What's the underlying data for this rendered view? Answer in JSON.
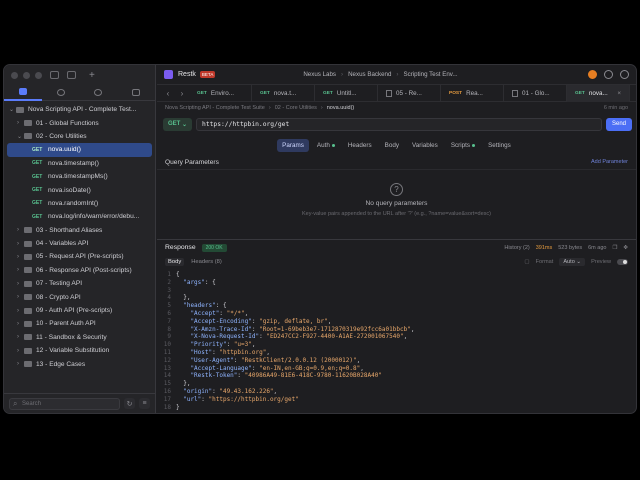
{
  "sidebar": {
    "root": "Nova Scripting API - Complete Test...",
    "folders_before": [
      {
        "label": "01 - Global Functions"
      },
      {
        "label": "02 - Core Utilities"
      }
    ],
    "requests": [
      {
        "method": "GET",
        "label": "nova.uuid()",
        "selected": true
      },
      {
        "method": "GET",
        "label": "nova.timestamp()"
      },
      {
        "method": "GET",
        "label": "nova.timestampMs()"
      },
      {
        "method": "GET",
        "label": "nova.isoDate()"
      },
      {
        "method": "GET",
        "label": "nova.randomInt()"
      },
      {
        "method": "GET",
        "label": "nova.log/info/warn/error/debu..."
      }
    ],
    "folders_after": [
      {
        "label": "03 - Shorthand Aliases"
      },
      {
        "label": "04 - Variables API"
      },
      {
        "label": "05 - Request API (Pre-scripts)"
      },
      {
        "label": "06 - Response API (Post-scripts)"
      },
      {
        "label": "07 - Testing API"
      },
      {
        "label": "08 - Crypto API"
      },
      {
        "label": "09 - Auth API (Pre-scripts)"
      },
      {
        "label": "10 - Parent Auth API"
      },
      {
        "label": "11 - Sandbox & Security"
      },
      {
        "label": "12 - Variable Substitution"
      },
      {
        "label": "13 - Edge Cases"
      }
    ],
    "search_placeholder": "Search"
  },
  "topbar": {
    "app": "Restk",
    "badge": "BETA",
    "crumbs": [
      "Nexus Labs",
      "Nexus Backend",
      "Scripting Test Env..."
    ]
  },
  "tabs": [
    {
      "method": "GET",
      "label": "Enviro...",
      "active": false
    },
    {
      "method": "GET",
      "label": "nova.t...",
      "active": false
    },
    {
      "method": "GET",
      "label": "Untitl...",
      "active": false
    },
    {
      "method": "",
      "label": "05 - Re...",
      "active": false
    },
    {
      "method": "POST",
      "label": "Rea...",
      "active": false
    },
    {
      "method": "",
      "label": "01 - Glo...",
      "active": false
    },
    {
      "method": "GET",
      "label": "nova...",
      "active": true
    }
  ],
  "request": {
    "crumb": [
      "Nova Scripting API - Complete Test Suite",
      "02 - Core Utilities",
      "nova.uuid()"
    ],
    "ago": "6 min ago",
    "method": "GET",
    "url": "https://httpbin.org/get",
    "send": "Send",
    "tabs": [
      "Params",
      "Auth",
      "Headers",
      "Body",
      "Variables",
      "Scripts",
      "Settings"
    ],
    "active_tab": "Params"
  },
  "query": {
    "title": "Query Parameters",
    "add": "Add Parameter",
    "empty_title": "No query parameters",
    "empty_hint": "Key-value pairs appended to the URL after '?' (e.g., ?name=value&sort=desc)"
  },
  "response": {
    "title": "Response",
    "status": "200 OK",
    "history": "History (2)",
    "time": "391ms",
    "size": "523 bytes",
    "ago": "6m ago",
    "tabs": [
      "Body",
      "Headers (8)"
    ],
    "format_label": "Format",
    "format_value": "Auto",
    "preview_label": "Preview",
    "lines": [
      [
        [
          "p",
          "{"
        ]
      ],
      [
        [
          "k",
          "  \"args\""
        ],
        [
          "p",
          ": {"
        ]
      ],
      [
        [
          "p",
          ""
        ]
      ],
      [
        [
          "p",
          "  },"
        ]
      ],
      [
        [
          "k",
          "  \"headers\""
        ],
        [
          "p",
          ": {"
        ]
      ],
      [
        [
          "k",
          "    \"Accept\""
        ],
        [
          "p",
          ": "
        ],
        [
          "s",
          "\"*/*\""
        ],
        [
          "p",
          ","
        ]
      ],
      [
        [
          "k",
          "    \"Accept-Encoding\""
        ],
        [
          "p",
          ": "
        ],
        [
          "s",
          "\"gzip, deflate, br\""
        ],
        [
          "p",
          ","
        ]
      ],
      [
        [
          "k",
          "    \"X-Amzn-Trace-Id\""
        ],
        [
          "p",
          ": "
        ],
        [
          "s",
          "\"Root=1-69beb3e7-1712870319e92fcc6a01bbcb\""
        ],
        [
          "p",
          ","
        ]
      ],
      [
        [
          "k",
          "    \"X-Nova-Request-Id\""
        ],
        [
          "p",
          ": "
        ],
        [
          "s",
          "\"ED247CC2-F927-4400-A1AE-272001067540\""
        ],
        [
          "p",
          ","
        ]
      ],
      [
        [
          "k",
          "    \"Priority\""
        ],
        [
          "p",
          ": "
        ],
        [
          "s",
          "\"u=3\""
        ],
        [
          "p",
          ","
        ]
      ],
      [
        [
          "k",
          "    \"Host\""
        ],
        [
          "p",
          ": "
        ],
        [
          "s",
          "\"httpbin.org\""
        ],
        [
          "p",
          ","
        ]
      ],
      [
        [
          "k",
          "    \"User-Agent\""
        ],
        [
          "p",
          ": "
        ],
        [
          "s",
          "\"RestkClient/2.0.0.12 (2000012)\""
        ],
        [
          "p",
          ","
        ]
      ],
      [
        [
          "k",
          "    \"Accept-Language\""
        ],
        [
          "p",
          ": "
        ],
        [
          "s",
          "\"en-IN,en-GB;q=0.9,en;q=0.8\""
        ],
        [
          "p",
          ","
        ]
      ],
      [
        [
          "k",
          "    \"Restk-Token\""
        ],
        [
          "p",
          ": "
        ],
        [
          "s",
          "\"40986A49-81E6-418C-9780-11620B028A40\""
        ]
      ],
      [
        [
          "p",
          "  },"
        ]
      ],
      [
        [
          "k",
          "  \"origin\""
        ],
        [
          "p",
          ": "
        ],
        [
          "s",
          "\"49.43.162.226\""
        ],
        [
          "p",
          ","
        ]
      ],
      [
        [
          "k",
          "  \"url\""
        ],
        [
          "p",
          ": "
        ],
        [
          "s",
          "\"https://httpbin.org/get\""
        ]
      ],
      [
        [
          "p",
          "}"
        ]
      ]
    ]
  }
}
